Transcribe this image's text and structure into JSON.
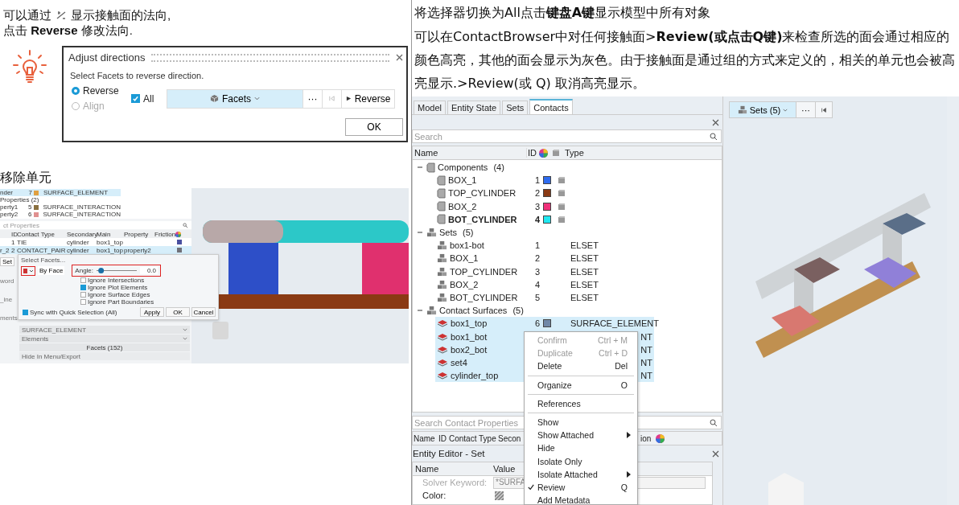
{
  "left": {
    "intro_a": "可以通过",
    "intro_b": "显示接触面的法向,",
    "intro_2": "点击 **Reverse** 修改法向.",
    "dialog": {
      "title": "Adjust directions",
      "instruction": "Select Facets to reverse direction.",
      "modes": [
        {
          "label": "Reverse",
          "selected": true,
          "disabled": false
        },
        {
          "label": "Align",
          "selected": false,
          "disabled": true
        }
      ],
      "all": {
        "label": "All",
        "checked": true
      },
      "selector": "Facets",
      "more": "···",
      "action": "Reverse",
      "ok": "OK"
    },
    "heading": "移除单元",
    "shot": {
      "list": [
        {
          "kind": "item",
          "name": "nder",
          "id": "7",
          "color": "#e0a040",
          "type": "SURFACE_ELEMENT",
          "selected": true
        },
        {
          "kind": "group",
          "name": "Properties  (2)",
          "selected": false
        },
        {
          "kind": "item",
          "name": "perty1",
          "id": "5",
          "color": "#8a7040",
          "type": "SURFACE_INTERACTION",
          "selected": false
        },
        {
          "kind": "item",
          "name": "perty2",
          "id": "6",
          "color": "#e09090",
          "type": "SURFACE_INTERACTION",
          "selected": false
        }
      ],
      "search": "ct Properties",
      "columns": [
        "ID",
        "Contact Type",
        "Secondary",
        "Main",
        "Property",
        "Friction"
      ],
      "rows": [
        {
          "name": "",
          "id": "1",
          "type": "TIE",
          "secondary": "cylinder",
          "main": "box1_top",
          "property": "",
          "color": "#4a50a0",
          "selected": false
        },
        {
          "name": "r_2",
          "id": "2",
          "type": "CONTACT_PAIR",
          "secondary": "cylinder",
          "main": "box1_top",
          "property": "property2",
          "color": "#707078",
          "selected": true
        }
      ],
      "set_button": "Set",
      "side_labels": [
        "word",
        "_ine",
        "ments"
      ],
      "fields": [
        {
          "kind": "dropdown",
          "value": "SURFACE_ELEMENT"
        },
        {
          "kind": "dropdown",
          "value": "Elements"
        },
        {
          "kind": "button",
          "value": "Facets (152)"
        },
        {
          "kind": "text",
          "value": "Hide In Menu/Export"
        }
      ],
      "facets": {
        "title": "Select Facets...",
        "mode": "By Face",
        "angle_label": "Angle:",
        "angle": "0.0",
        "level": 0.05,
        "options": [
          {
            "label": "Ignore Intersections",
            "checked": false
          },
          {
            "label": "Ignore Plot Elements",
            "checked": true
          },
          {
            "label": "Ignore Surface Edges",
            "checked": false
          },
          {
            "label": "Ignore Part Boundaries",
            "checked": false
          }
        ],
        "sync": {
          "label": "Sync with Quick Selection (All)",
          "checked": true
        },
        "buttons": [
          "Apply",
          "OK",
          "Cancel"
        ]
      }
    }
  },
  "right": {
    "p1": "将选择器切换为All点击**键盘A键**显示模型中所有对象",
    "p2": "可以在ContactBrowser中对任何接触面>**Review(或点击Q键)**来检查所选的面会通过相应的颜色高亮，其他的面会显示为灰色。由于接触面是通过组的方式来定义的，相关的单元也会被高亮显示.>Review(或 Q)  取消高亮显示。",
    "tabs": [
      {
        "label": "Model",
        "selected": false
      },
      {
        "label": "Entity State",
        "selected": false
      },
      {
        "label": "Sets",
        "selected": false
      },
      {
        "label": "Contacts",
        "selected": true
      }
    ],
    "search": "Search",
    "columns": [
      "Name",
      "ID",
      "Type"
    ],
    "tree": [
      {
        "label": "Components",
        "count": "(4)",
        "kind": "component",
        "expanded": true,
        "children": [
          {
            "label": "BOX_1",
            "id": "1",
            "color": "#2f6cf0",
            "current": false,
            "selected": false
          },
          {
            "label": "TOP_CYLINDER",
            "id": "2",
            "color": "#8a3a14",
            "current": false,
            "selected": false
          },
          {
            "label": "BOX_2",
            "id": "3",
            "color": "#f0307a",
            "current": false,
            "selected": false
          },
          {
            "label": "BOT_CYLINDER",
            "id": "4",
            "color": "#20e8f0",
            "current": true,
            "selected": false
          }
        ]
      },
      {
        "label": "Sets",
        "count": "(5)",
        "kind": "set",
        "expanded": true,
        "children": [
          {
            "label": "box1-bot",
            "id": "1",
            "type": "ELSET",
            "selected": false
          },
          {
            "label": "BOX_1",
            "id": "2",
            "type": "ELSET",
            "selected": false
          },
          {
            "label": "TOP_CYLINDER",
            "id": "3",
            "type": "ELSET",
            "selected": false
          },
          {
            "label": "BOX_2",
            "id": "4",
            "type": "ELSET",
            "selected": false
          },
          {
            "label": "BOT_CYLINDER",
            "id": "5",
            "type": "ELSET",
            "selected": false
          }
        ]
      },
      {
        "label": "Contact Surfaces",
        "count": "(5)",
        "kind": "surface",
        "expanded": true,
        "children": [
          {
            "label": "box1_top",
            "id": "6",
            "color": "#7088a8",
            "type": "SURFACE_ELEMENT",
            "selected": true,
            "covered": false
          },
          {
            "label": "box1_bot",
            "type": "NT",
            "selected": true,
            "covered": true
          },
          {
            "label": "box2_bot",
            "type": "NT",
            "selected": true,
            "covered": true
          },
          {
            "label": "set4",
            "type": "NT",
            "selected": true,
            "covered": true
          },
          {
            "label": "cylinder_top",
            "type": "NT",
            "selected": true,
            "covered": true
          }
        ]
      }
    ],
    "menu": [
      {
        "kind": "item",
        "label": "Confirm",
        "shortcut": "Ctrl + M",
        "disabled": true,
        "checked": false,
        "submenu": false
      },
      {
        "kind": "item",
        "label": "Duplicate",
        "shortcut": "Ctrl + D",
        "disabled": true,
        "checked": false,
        "submenu": false
      },
      {
        "kind": "item",
        "label": "Delete",
        "shortcut": "Del",
        "disabled": false,
        "checked": false,
        "submenu": false
      },
      {
        "kind": "separator"
      },
      {
        "kind": "item",
        "label": "Organize",
        "shortcut": "O",
        "disabled": false,
        "checked": false,
        "submenu": false
      },
      {
        "kind": "separator"
      },
      {
        "kind": "item",
        "label": "References",
        "disabled": false,
        "checked": false,
        "submenu": false
      },
      {
        "kind": "separator"
      },
      {
        "kind": "item",
        "label": "Show",
        "disabled": false,
        "checked": false,
        "submenu": false
      },
      {
        "kind": "item",
        "label": "Show Attached",
        "disabled": false,
        "checked": false,
        "submenu": true
      },
      {
        "kind": "item",
        "label": "Hide",
        "disabled": false,
        "checked": false,
        "submenu": false
      },
      {
        "kind": "item",
        "label": "Isolate Only",
        "disabled": false,
        "checked": false,
        "submenu": false
      },
      {
        "kind": "item",
        "label": "Isolate Attached",
        "disabled": false,
        "checked": false,
        "submenu": true
      },
      {
        "kind": "item",
        "label": "Review",
        "shortcut": "Q",
        "disabled": false,
        "checked": true,
        "submenu": false
      },
      {
        "kind": "item",
        "label": "Add Metadata",
        "disabled": false,
        "checked": false,
        "submenu": false
      }
    ],
    "search2": "Search Contact Properties",
    "columns2": [
      "Name",
      "ID",
      "Contact Type",
      "Secon",
      "ion"
    ],
    "editor": {
      "title": "Entity Editor - Set",
      "columns": [
        "Name",
        "Value"
      ],
      "rows": [
        {
          "kind": "text",
          "label": "Solver Keyword:",
          "value": "*SURFA",
          "disabled": true
        },
        {
          "kind": "swatch",
          "label": "Color:",
          "disabled": false
        }
      ]
    },
    "toolbar": {
      "selector": "Sets (5)",
      "more": "···"
    }
  }
}
